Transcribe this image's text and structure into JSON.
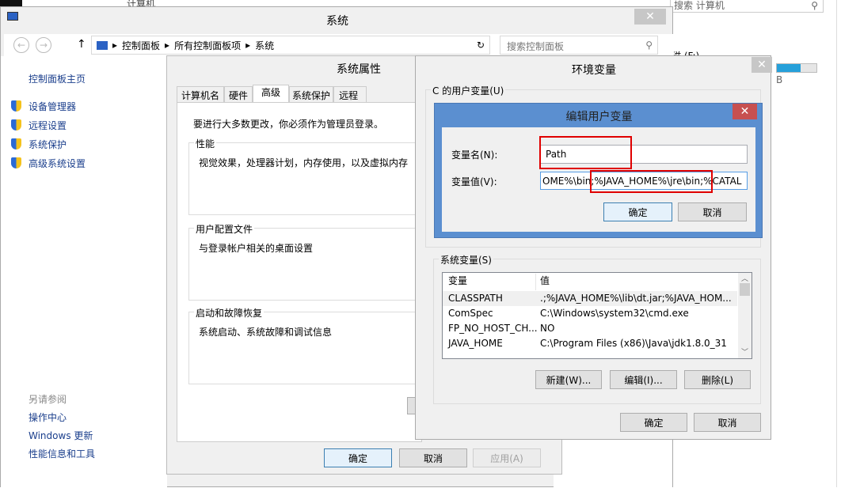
{
  "background": {
    "explorer_path": "计算机",
    "search_placeholder": "搜索 计算机",
    "drive_label": "磁 (F:)",
    "drive_size_fragment": "B",
    "drive_fill": 0.6
  },
  "system_window": {
    "title": "系统",
    "breadcrumb": [
      "控制面板",
      "所有控制面板项",
      "系统"
    ],
    "search_placeholder": "搜索控制面板",
    "sidebar": {
      "home": "控制面板主页",
      "items": [
        "设备管理器",
        "远程设置",
        "系统保护",
        "高级系统设置"
      ],
      "see_also": "另请参阅",
      "links": [
        "操作中心",
        "Windows 更新",
        "性能信息和工具"
      ]
    }
  },
  "system_properties": {
    "title": "系统属性",
    "tabs": [
      "计算机名",
      "硬件",
      "高级",
      "系统保护",
      "远程"
    ],
    "active_tab": "高级",
    "admin_note": "要进行大多数更改，你必须作为管理员登录。",
    "groups": [
      {
        "title": "性能",
        "desc": "视觉效果，处理器计划，内存使用，以及虚拟内存"
      },
      {
        "title": "用户配置文件",
        "desc": "与登录帐户相关的桌面设置"
      },
      {
        "title": "启动和故障恢复",
        "desc": "系统启动、系统故障和调试信息"
      }
    ],
    "ok": "确定",
    "cancel": "取消",
    "apply": "应用(A)"
  },
  "env_vars": {
    "title": "环境变量",
    "user_group_fragment": "C 的用户变量(U)",
    "system_group": "系统变量(S)",
    "col_var": "变量",
    "col_val": "值",
    "rows": [
      {
        "name": "CLASSPATH",
        "value": ".;%JAVA_HOME%\\lib\\dt.jar;%JAVA_HOM..."
      },
      {
        "name": "ComSpec",
        "value": "C:\\Windows\\system32\\cmd.exe"
      },
      {
        "name": "FP_NO_HOST_CH...",
        "value": "NO"
      },
      {
        "name": "JAVA_HOME",
        "value": "C:\\Program Files (x86)\\Java\\jdk1.8.0_31"
      }
    ],
    "new": "新建(W)...",
    "edit": "编辑(I)...",
    "delete": "删除(L)",
    "ok": "确定",
    "cancel": "取消"
  },
  "edit_dialog": {
    "title": "编辑用户变量",
    "name_label": "变量名(N):",
    "name_value": "Path",
    "value_label": "变量值(V):",
    "value_value": "OME%\\bin;%JAVA_HOME%\\jre\\bin;%CATAL",
    "ok": "确定",
    "cancel": "取消",
    "highlight_color": "#e00000",
    "border_color": "#5b8fd0"
  }
}
